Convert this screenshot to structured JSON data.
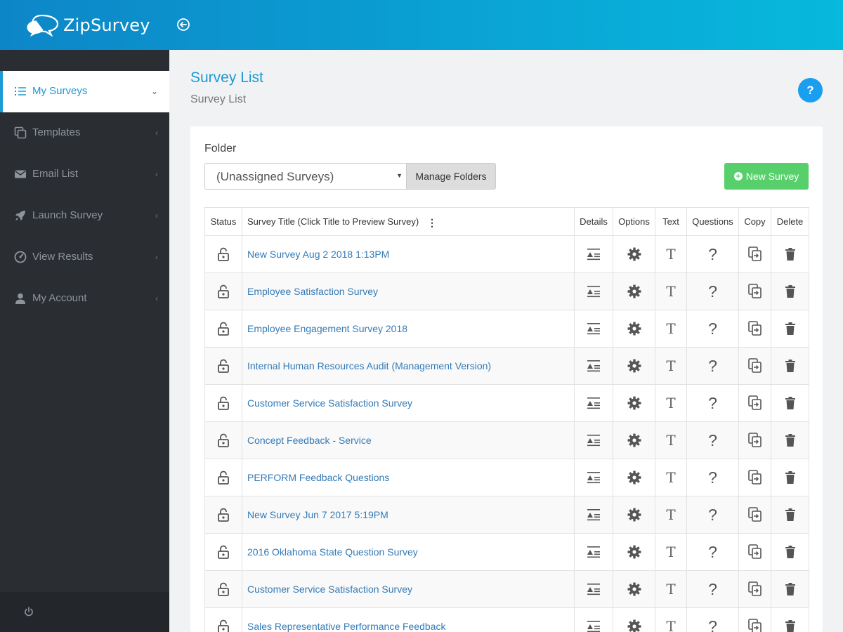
{
  "app": {
    "name": "ZipSurvey"
  },
  "sidebar": {
    "items": [
      {
        "label": "My Surveys",
        "icon": "list-icon",
        "active": true
      },
      {
        "label": "Templates",
        "icon": "copy-icon"
      },
      {
        "label": "Email List",
        "icon": "envelope-icon"
      },
      {
        "label": "Launch Survey",
        "icon": "rocket-icon"
      },
      {
        "label": "View Results",
        "icon": "dashboard-icon"
      },
      {
        "label": "My Account",
        "icon": "user-icon"
      }
    ]
  },
  "page": {
    "title": "Survey List",
    "subtitle": "Survey List",
    "help": "?"
  },
  "folder": {
    "label": "Folder",
    "selected": "(Unassigned Surveys)",
    "manage_label": "Manage Folders"
  },
  "new_survey_label": "New Survey",
  "table": {
    "headers": {
      "status": "Status",
      "title": "Survey Title (Click Title to Preview Survey)",
      "details": "Details",
      "options": "Options",
      "text": "Text",
      "questions": "Questions",
      "copy": "Copy",
      "delete": "Delete"
    },
    "rows": [
      "New Survey Aug 2 2018 1:13PM",
      "Employee Satisfaction Survey",
      "Employee Engagement Survey 2018",
      "Internal Human Resources Audit (Management Version)",
      "Customer Service Satisfaction Survey",
      "Concept Feedback - Service",
      "PERFORM Feedback Questions",
      "New Survey Jun 7 2017 5:19PM",
      "2016 Oklahoma State Question Survey",
      "Customer Service Satisfaction Survey",
      "Sales Representative Performance Feedback"
    ],
    "cell_glyphs": {
      "text": "T",
      "questions": "?"
    }
  },
  "colors": {
    "accent": "#1a9ad6",
    "header_start": "#0d86c7",
    "header_end": "#07b9dc",
    "new_button": "#57d06b",
    "sidebar": "#2a2e33",
    "link": "#337ab7"
  }
}
